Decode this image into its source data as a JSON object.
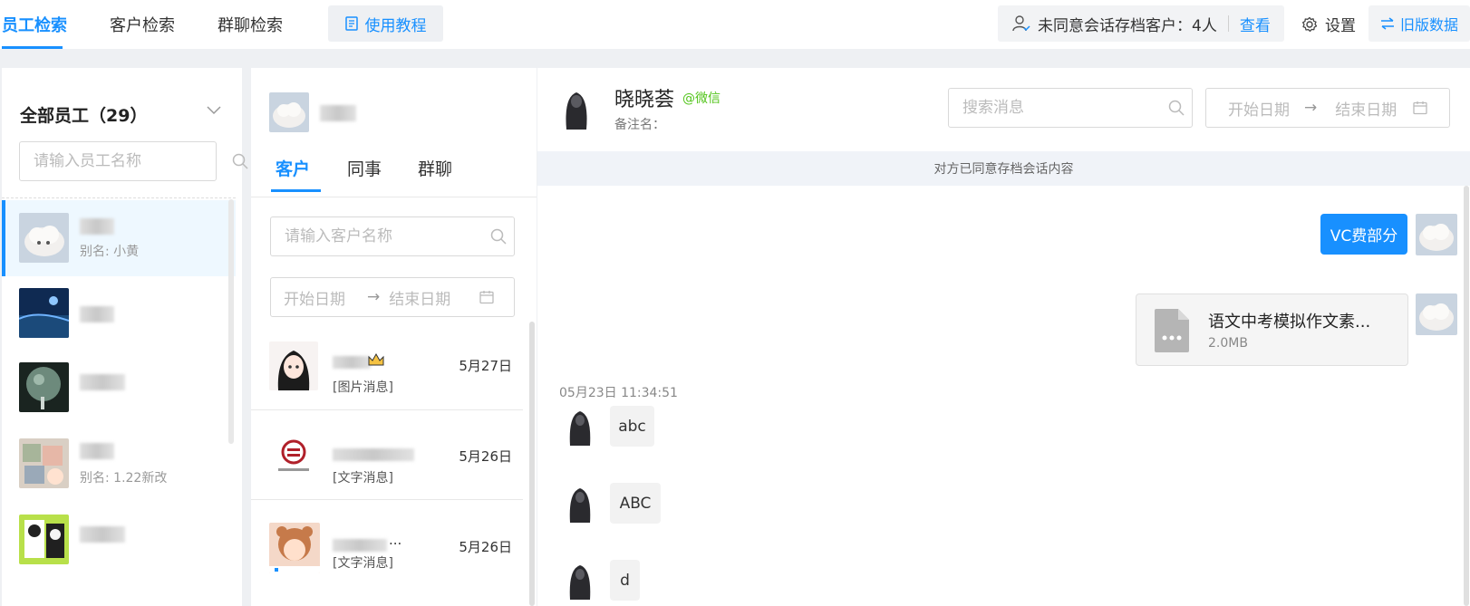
{
  "topbar": {
    "tabs": [
      "员工检索",
      "客户检索",
      "群聊检索"
    ],
    "tutorial_label": "使用教程",
    "notice_label": "未同意会话存档客户：4人",
    "view_label": "查看",
    "settings_label": "设置",
    "legacy_label": "旧版数据",
    "accent_color": "#1890ff"
  },
  "staff": {
    "header": "全部员工（29）",
    "search_placeholder": "请输入员工名称",
    "items": [
      {
        "alias": "别名: 小黄"
      },
      {
        "alias": ""
      },
      {
        "alias": ""
      },
      {
        "alias": "别名: 1.22新改"
      },
      {
        "alias": ""
      }
    ]
  },
  "customers": {
    "tabs": [
      "客户",
      "同事",
      "群聊"
    ],
    "search_placeholder": "请输入客户名称",
    "date_start": "开始日期",
    "date_end": "结束日期",
    "date_arrow": "→",
    "items": [
      {
        "date": "5月27日",
        "msg": "[图片消息]"
      },
      {
        "date": "5月26日",
        "msg": "[文字消息]"
      },
      {
        "date": "5月26日",
        "msg": "[文字消息]",
        "name_suffix": "..."
      }
    ]
  },
  "chat": {
    "name": "晓晓荟",
    "source": "@微信",
    "remark_label": "备注名：",
    "search_placeholder": "搜索消息",
    "date_start": "开始日期",
    "date_end": "结束日期",
    "date_arrow": "→",
    "consent_text": "对方已同意存档会话内容",
    "messages": {
      "outgoing_text": "VC费部分",
      "file_name": "语文中考模拟作文素...",
      "file_size": "2.0MB",
      "timestamp": "05月23日 11:34:51",
      "incoming": [
        "abc",
        "ABC",
        "d"
      ]
    }
  }
}
